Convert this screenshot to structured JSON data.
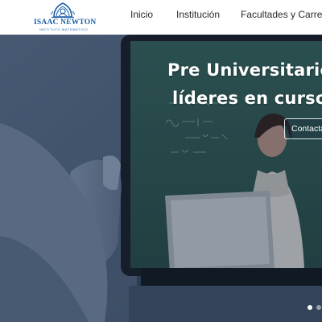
{
  "brand": {
    "title": "ISAAC NEWTON",
    "subtitle": "INSTITUTO MATEMÁTICO",
    "color": "#1b5fa8"
  },
  "nav": {
    "items": [
      {
        "label": "Inicio"
      },
      {
        "label": "Institución"
      },
      {
        "label": "Facultades y Carreras"
      }
    ]
  },
  "hero": {
    "line1": "Pre Universitarios",
    "line2": "líderes en cursos",
    "contact_label": "Contacta",
    "overlay_color": "#2c3f5a",
    "slides_active": 1
  }
}
